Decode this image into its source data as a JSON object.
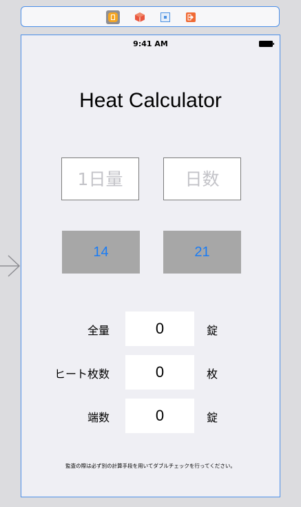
{
  "status_bar": {
    "time": "9:41 AM"
  },
  "scene_dock": {
    "icons": [
      "view-controller-icon",
      "first-responder-icon",
      "exit-icon",
      "storyboard-reference-icon"
    ],
    "colors": {
      "view_controller": "#f5a623",
      "first_responder": "#e9573f",
      "exit": "#4a90e2",
      "storyboard_reference": "#f06a35"
    }
  },
  "app": {
    "title": "Heat Calculator"
  },
  "inputs": {
    "daily_amount": {
      "value": "",
      "placeholder": "1日量"
    },
    "days": {
      "value": "",
      "placeholder": "日数"
    }
  },
  "presets": {
    "button_14": "14",
    "button_21": "21"
  },
  "results": {
    "total": {
      "label": "全量",
      "value": "0",
      "unit": "錠"
    },
    "sheets": {
      "label": "ヒート枚数",
      "value": "0",
      "unit": "枚"
    },
    "remainder": {
      "label": "端数",
      "value": "0",
      "unit": "錠"
    }
  },
  "footnote": "監査の際は必ず別の計算手段を用いてダブルチェックを行ってください。",
  "colors": {
    "frame_border": "#4a8ee8",
    "button_background": "#a7a7a7",
    "button_text": "#1a7cf5",
    "placeholder": "#c3c3c8",
    "view_background": "#efeff4"
  }
}
